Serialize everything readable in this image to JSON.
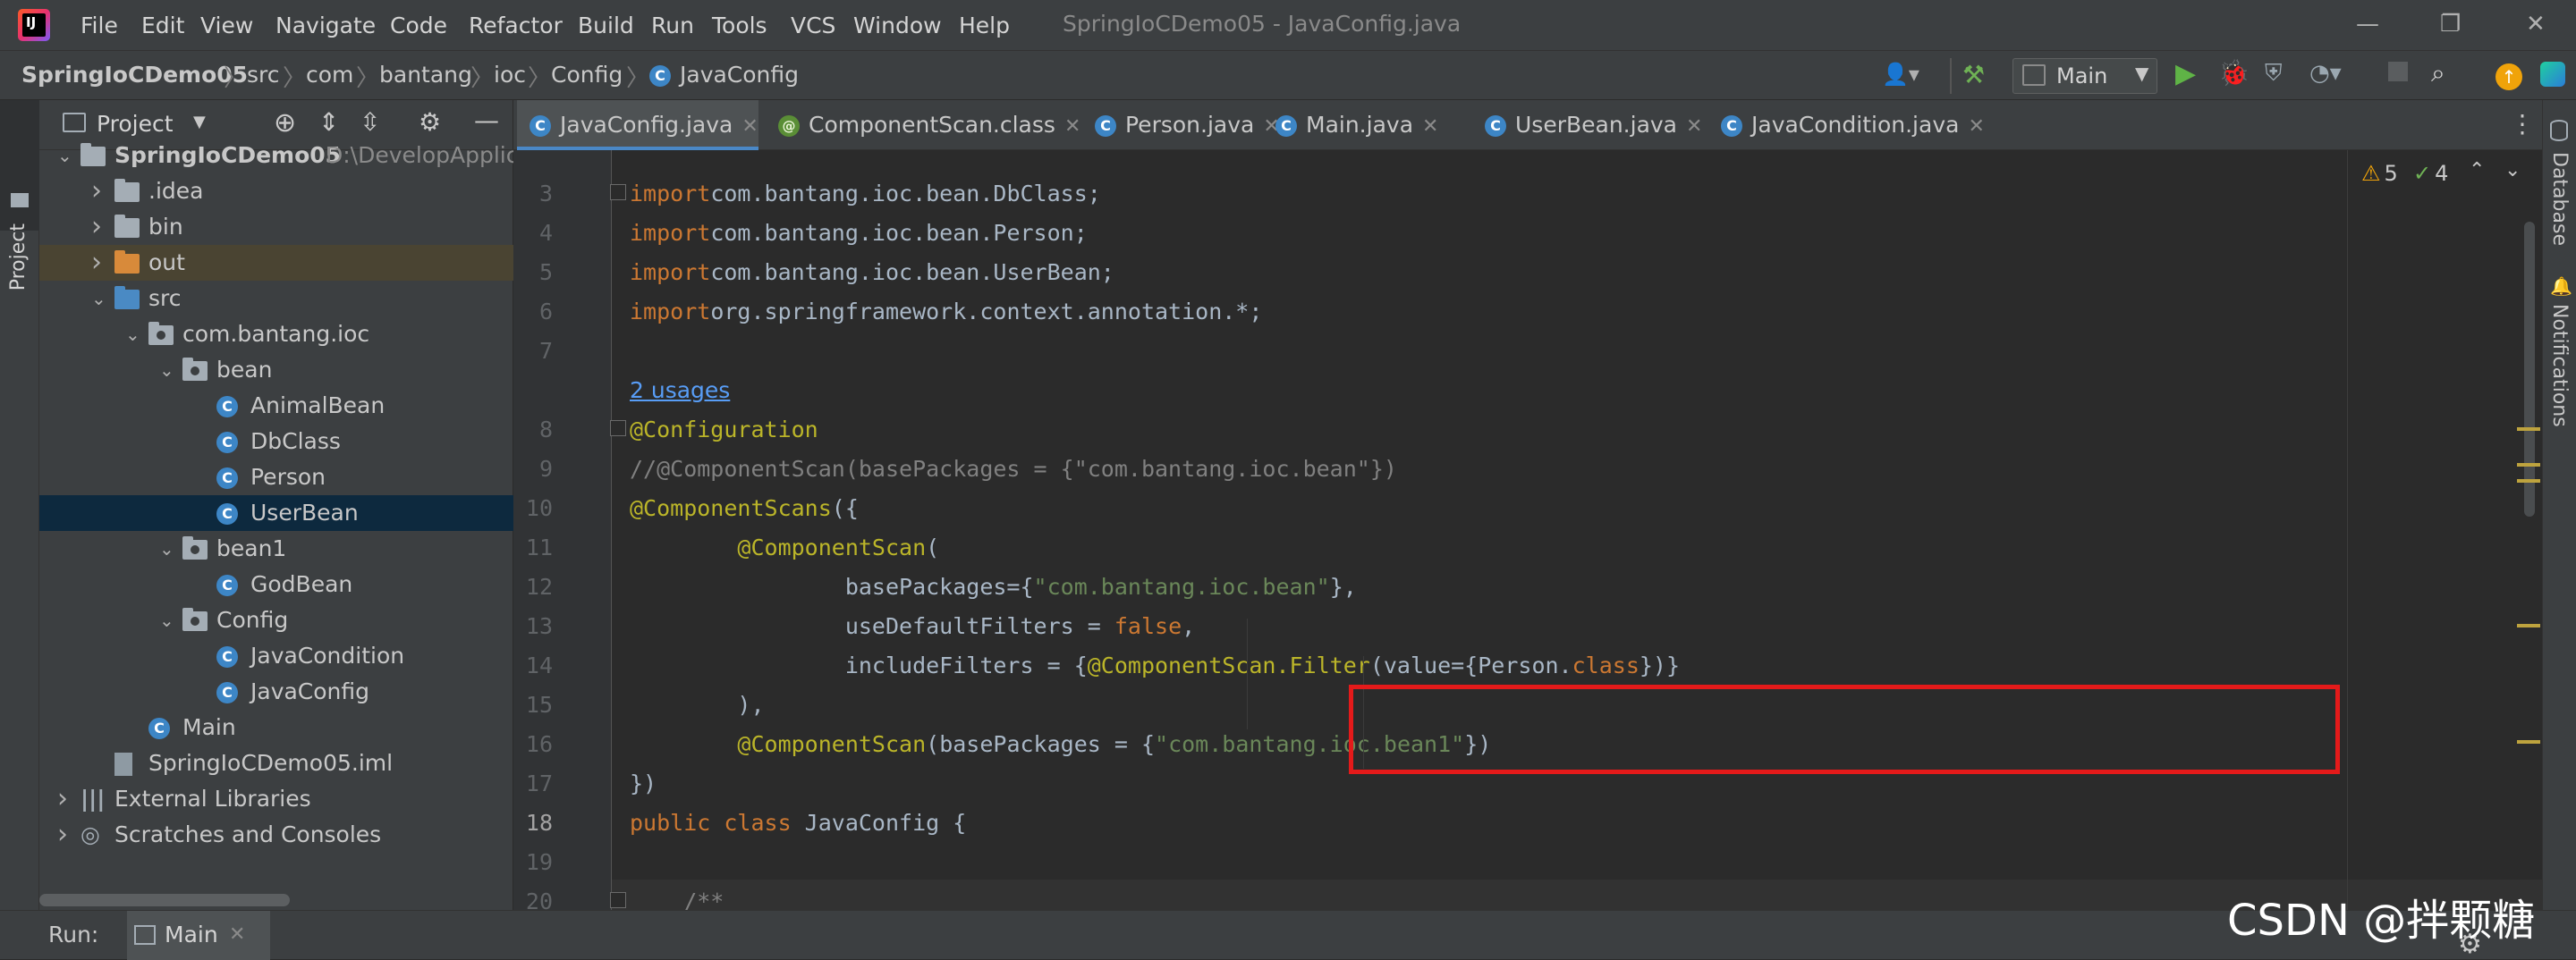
{
  "window": {
    "title": "SpringIoCDemo05 - JavaConfig.java"
  },
  "menu": [
    "File",
    "Edit",
    "View",
    "Navigate",
    "Code",
    "Refactor",
    "Build",
    "Run",
    "Tools",
    "VCS",
    "Window",
    "Help"
  ],
  "breadcrumb": [
    "SpringIoCDemo05",
    "src",
    "com",
    "bantang",
    "ioc",
    "Config",
    "JavaConfig"
  ],
  "run_config": "Main",
  "project_panel": {
    "title": "Project",
    "side_label": "Project",
    "tree": [
      {
        "label": "SpringIoCDemo05",
        "extra": "D:\\DevelopApplica",
        "indent": 0,
        "kind": "module",
        "expanded": true
      },
      {
        "label": ".idea",
        "indent": 1,
        "kind": "folder",
        "expanded": false
      },
      {
        "label": "bin",
        "indent": 1,
        "kind": "folder",
        "expanded": false
      },
      {
        "label": "out",
        "indent": 1,
        "kind": "folder-orange",
        "expanded": false
      },
      {
        "label": "src",
        "indent": 1,
        "kind": "folder-blue",
        "expanded": true
      },
      {
        "label": "com.bantang.ioc",
        "indent": 2,
        "kind": "package",
        "expanded": true
      },
      {
        "label": "bean",
        "indent": 3,
        "kind": "package",
        "expanded": true
      },
      {
        "label": "AnimalBean",
        "indent": 4,
        "kind": "class"
      },
      {
        "label": "DbClass",
        "indent": 4,
        "kind": "class"
      },
      {
        "label": "Person",
        "indent": 4,
        "kind": "class"
      },
      {
        "label": "UserBean",
        "indent": 4,
        "kind": "class",
        "selected": true
      },
      {
        "label": "bean1",
        "indent": 3,
        "kind": "package",
        "expanded": true
      },
      {
        "label": "GodBean",
        "indent": 4,
        "kind": "class"
      },
      {
        "label": "Config",
        "indent": 3,
        "kind": "package",
        "expanded": true
      },
      {
        "label": "JavaCondition",
        "indent": 4,
        "kind": "class"
      },
      {
        "label": "JavaConfig",
        "indent": 4,
        "kind": "class"
      },
      {
        "label": "Main",
        "indent": 2,
        "kind": "class-main"
      },
      {
        "label": "SpringIoCDemo05.iml",
        "indent": 1,
        "kind": "file"
      },
      {
        "label": "External Libraries",
        "indent": 0,
        "kind": "libs",
        "expanded": false
      },
      {
        "label": "Scratches and Consoles",
        "indent": 0,
        "kind": "scratch",
        "expanded": false
      }
    ]
  },
  "tabs": [
    {
      "label": "JavaConfig.java",
      "icon": "C",
      "active": true
    },
    {
      "label": "ComponentScan.class",
      "icon": "@"
    },
    {
      "label": "Person.java",
      "icon": "C"
    },
    {
      "label": "Main.java",
      "icon": "C"
    },
    {
      "label": "UserBean.java",
      "icon": "C"
    },
    {
      "label": "JavaCondition.java",
      "icon": "C"
    }
  ],
  "inspections": {
    "warnings": "5",
    "weak": "4"
  },
  "code_lines": [
    {
      "n": "3",
      "tokens": [
        [
          "kw",
          "import"
        ],
        [
          "",
          "com.bantang.ioc.bean.DbClass;"
        ]
      ]
    },
    {
      "n": "4",
      "tokens": [
        [
          "kw",
          "import"
        ],
        [
          "",
          "com.bantang.ioc.bean.Person;"
        ]
      ]
    },
    {
      "n": "5",
      "tokens": [
        [
          "kw",
          "import"
        ],
        [
          "",
          "com.bantang.ioc.bean.UserBean;"
        ]
      ]
    },
    {
      "n": "6",
      "tokens": [
        [
          "kw",
          "import"
        ],
        [
          "",
          "org.springframework.context.annotation.*;"
        ]
      ]
    },
    {
      "n": "7",
      "tokens": []
    },
    {
      "n": "",
      "usages": "2 usages"
    },
    {
      "n": "8",
      "tokens": [
        [
          "an",
          "@Configuration"
        ]
      ]
    },
    {
      "n": "9",
      "tokens": [
        [
          "cm",
          "//@ComponentScan(basePackages = {\"com.bantang.ioc.bean\"})"
        ]
      ]
    },
    {
      "n": "10",
      "tokens": [
        [
          "an",
          "@ComponentScans"
        ],
        [
          "",
          "({"
        ]
      ]
    },
    {
      "n": "11",
      "tokens": [
        [
          "",
          "        "
        ],
        [
          "an",
          "@ComponentScan"
        ],
        [
          "",
          "("
        ]
      ]
    },
    {
      "n": "12",
      "tokens": [
        [
          "",
          "                basePackages={"
        ],
        [
          "str",
          "\"com.bantang.ioc.bean\""
        ],
        [
          "",
          "},"
        ]
      ]
    },
    {
      "n": "13",
      "tokens": [
        [
          "",
          "                useDefaultFilters = "
        ],
        [
          "kw",
          "false"
        ],
        [
          "",
          ","
        ]
      ]
    },
    {
      "n": "14",
      "tokens": [
        [
          "",
          "                includeFilters = {"
        ],
        [
          "an",
          "@ComponentScan.Filter"
        ],
        [
          "",
          "(value={Person."
        ],
        [
          "kw",
          "class"
        ],
        [
          "",
          "})}"
        ]
      ]
    },
    {
      "n": "15",
      "tokens": [
        [
          "",
          "        ),"
        ]
      ]
    },
    {
      "n": "16",
      "tokens": [
        [
          "",
          "        "
        ],
        [
          "an",
          "@ComponentScan"
        ],
        [
          "",
          "(basePackages = {"
        ],
        [
          "str",
          "\"com.bantang.ioc.bean1\""
        ],
        [
          "",
          "})"
        ]
      ]
    },
    {
      "n": "17",
      "tokens": [
        [
          "",
          "})"
        ]
      ]
    },
    {
      "n": "18",
      "tokens": [
        [
          "kw",
          "public class "
        ],
        [
          "",
          "JavaConfig {"
        ]
      ]
    },
    {
      "n": "19",
      "tokens": []
    },
    {
      "n": "20",
      "tokens": [
        [
          "cm",
          "    /**"
        ]
      ]
    }
  ],
  "right_sidebar": [
    "Database",
    "Notifications"
  ],
  "run_bar": {
    "label": "Run:",
    "config": "Main"
  },
  "watermark": "CSDN @拌颗糖",
  "colors": {
    "keyword": "#cc7832",
    "annotation": "#bbb529",
    "string": "#6a8759",
    "comment": "#808080",
    "highlight_box": "#e41a1a"
  }
}
